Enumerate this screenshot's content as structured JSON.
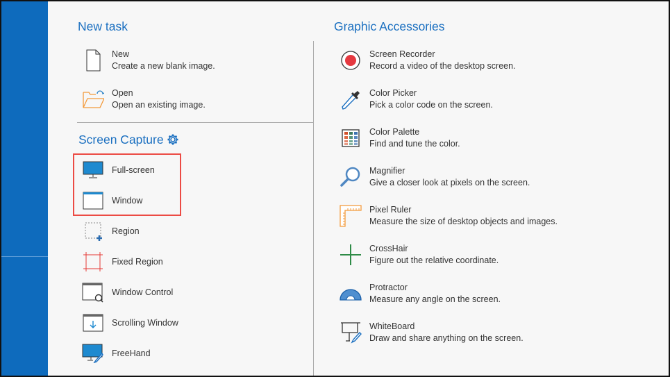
{
  "new_task": {
    "title": "New task",
    "items": [
      {
        "name": "New",
        "desc": "Create a new blank image."
      },
      {
        "name": "Open",
        "desc": "Open an existing image."
      }
    ]
  },
  "screen_capture": {
    "title": "Screen Capture",
    "items": [
      {
        "name": "Full-screen"
      },
      {
        "name": "Window"
      },
      {
        "name": "Region"
      },
      {
        "name": "Fixed Region"
      },
      {
        "name": "Window Control"
      },
      {
        "name": "Scrolling Window"
      },
      {
        "name": "FreeHand"
      }
    ]
  },
  "graphic_accessories": {
    "title": "Graphic Accessories",
    "items": [
      {
        "name": "Screen Recorder",
        "desc": "Record a video of the desktop screen."
      },
      {
        "name": "Color Picker",
        "desc": "Pick a color code on the screen."
      },
      {
        "name": "Color Palette",
        "desc": "Find and tune the color."
      },
      {
        "name": "Magnifier",
        "desc": "Give a closer look at pixels on the screen."
      },
      {
        "name": "Pixel Ruler",
        "desc": "Measure the size of desktop objects and images."
      },
      {
        "name": "CrossHair",
        "desc": "Figure out the relative coordinate."
      },
      {
        "name": "Protractor",
        "desc": "Measure any angle on the screen."
      },
      {
        "name": "WhiteBoard",
        "desc": "Draw and share anything on the screen."
      }
    ]
  },
  "colors": {
    "accent": "#1a6fc0",
    "sidebar": "#0e6bbd",
    "highlight": "#ec4b44"
  }
}
